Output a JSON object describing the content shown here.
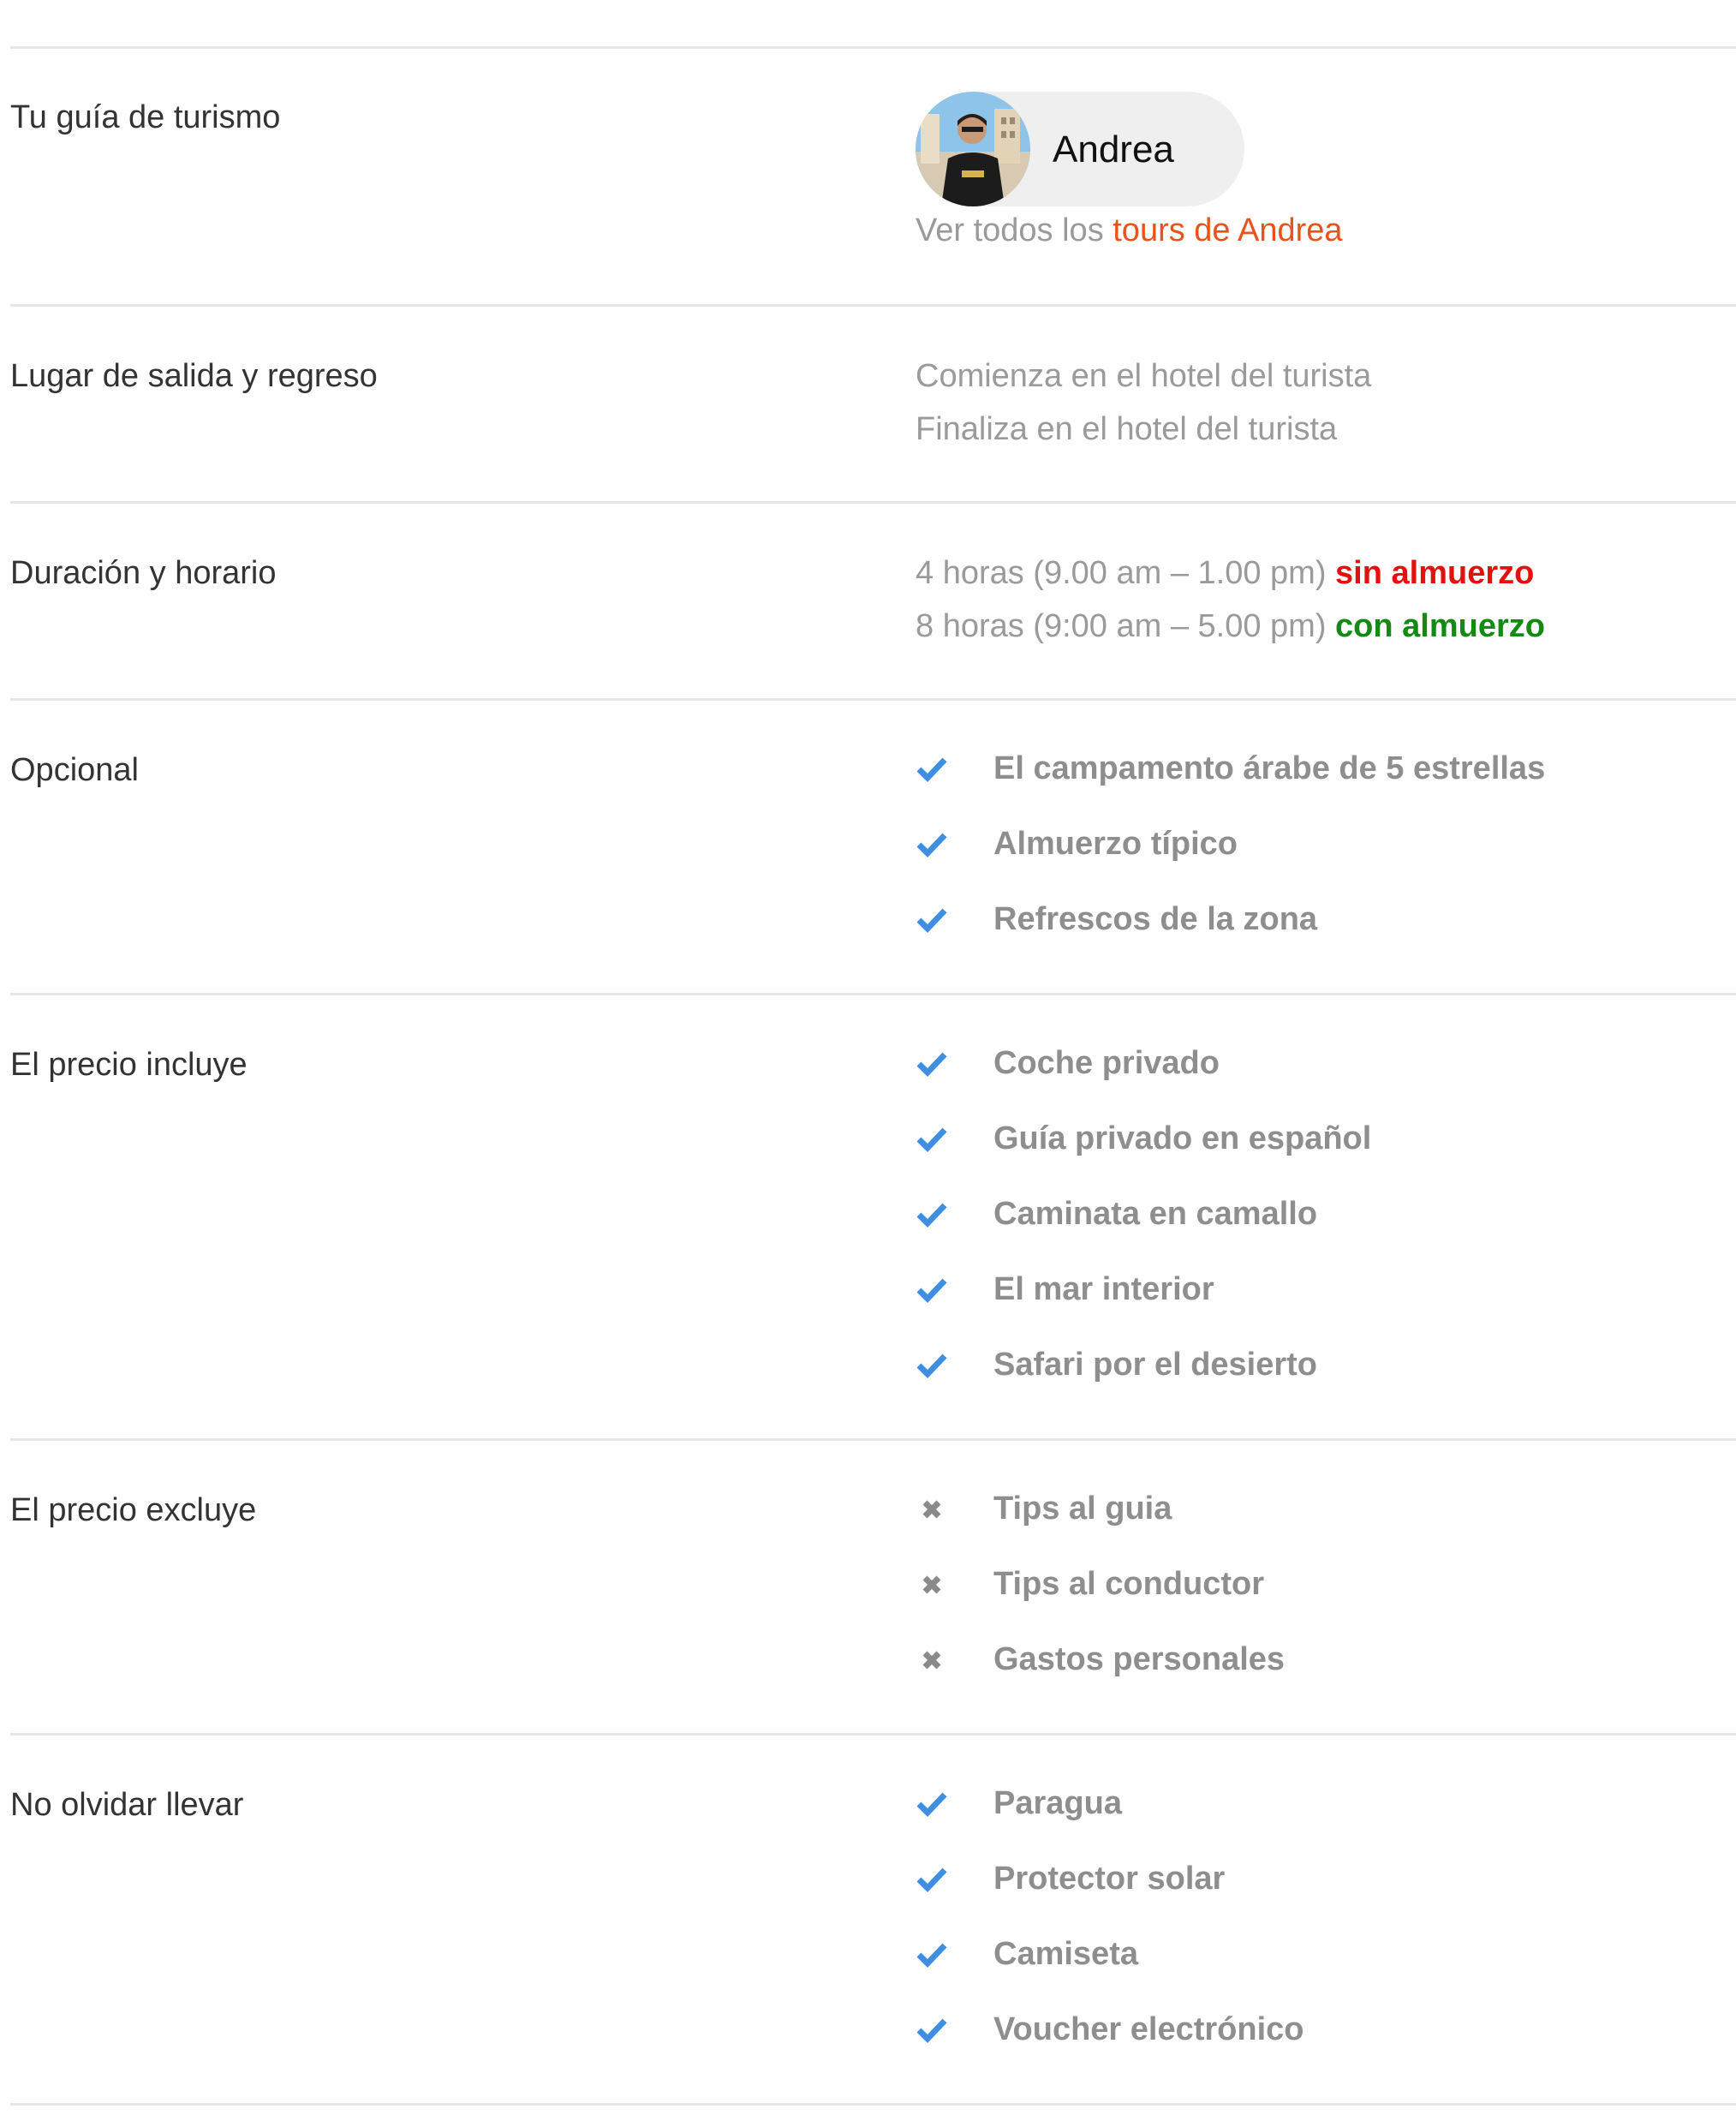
{
  "colors": {
    "check": "#3f8fe0",
    "cross": "#8a8a8a",
    "link": "#e8521c",
    "no_lunch": "#e31010",
    "with_lunch": "#138a13"
  },
  "guide": {
    "label": "Tu guía de turismo",
    "name": "Andrea",
    "tours_prefix": "Ver todos los ",
    "tours_link": "tours de Andrea"
  },
  "meeting": {
    "label": "Lugar de salida y regreso",
    "starts": "Comienza en el hotel del turista",
    "ends": "Finaliza en el hotel del turista"
  },
  "duration": {
    "label": "Duración y horario",
    "option1": "4 horas (9.00 am – 1.00 pm)",
    "option1_tag": "sin almuerzo",
    "option2": "8 horas (9:00 am – 5.00 pm)",
    "option2_tag": "con almuerzo"
  },
  "optional": {
    "label": "Opcional",
    "icon": "check-icon",
    "items": [
      "El campamento árabe de 5 estrellas",
      "Almuerzo típico",
      "Refrescos de la zona"
    ]
  },
  "includes": {
    "label": "El precio incluye",
    "icon": "check-icon",
    "items": [
      "Coche privado",
      "Guía privado en español",
      "Caminata en camallo",
      "El mar interior",
      "Safari por el desierto"
    ]
  },
  "excludes": {
    "label": "El precio excluye",
    "icon": "cross-icon",
    "items": [
      "Tips al guia",
      "Tips al conductor",
      "Gastos personales"
    ]
  },
  "bring": {
    "label": "No olvidar llevar",
    "icon": "check-icon",
    "items": [
      "Paragua",
      "Protector solar",
      "Camiseta",
      "Voucher electrónico"
    ]
  }
}
